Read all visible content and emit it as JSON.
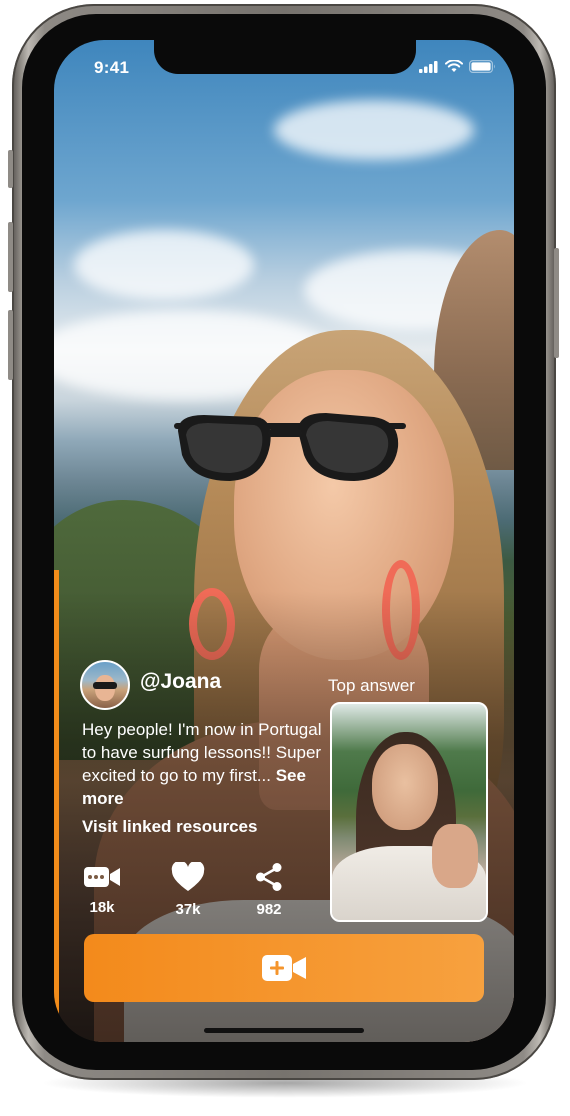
{
  "status_bar": {
    "time": "9:41"
  },
  "post": {
    "username": "@Joana",
    "caption": "Hey people! I'm now in Portugal to have surfung lessons!! Super excited to go to my first...",
    "see_more": "See more",
    "linked_resources": "Visit linked resources"
  },
  "actions": {
    "video_replies": {
      "count": "18k",
      "icon": "video-camera-icon"
    },
    "likes": {
      "count": "37k",
      "icon": "heart-icon"
    },
    "shares": {
      "count": "982",
      "icon": "share-icon"
    }
  },
  "top_answer": {
    "label": "Top answer"
  },
  "record": {
    "icon": "add-video-icon"
  },
  "colors": {
    "accent": "#F28C1A",
    "accent_light": "#F7A13F",
    "text": "#FFFFFF"
  }
}
